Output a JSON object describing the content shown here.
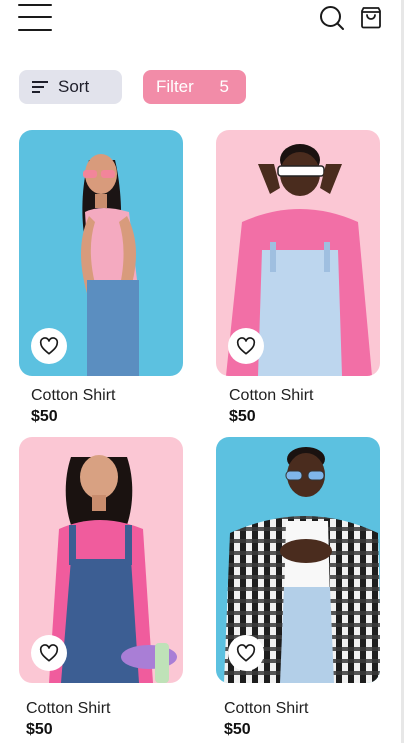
{
  "header": {
    "menu_icon": "hamburger-menu-icon",
    "search_icon": "search-icon",
    "bag_icon": "shopping-bag-icon"
  },
  "toolbar": {
    "sort_label": "Sort",
    "sort_icon": "sort-lines-icon",
    "filter_label": "Filter",
    "filter_count": "5"
  },
  "colors": {
    "accent_pink": "#f28ca8",
    "sort_bg": "#e2e3ec",
    "photo_blue": "#5cc1e0",
    "photo_pink": "#fbc7d4"
  },
  "products": [
    {
      "title": "Cotton Shirt",
      "price": "$50",
      "photo_bg": "#5cc1e0",
      "favorite_icon": "heart-outline-icon"
    },
    {
      "title": "Cotton Shirt",
      "price": "$50",
      "photo_bg": "#fbc7d4",
      "favorite_icon": "heart-outline-icon"
    },
    {
      "title": "Cotton Shirt",
      "price": "$50",
      "photo_bg": "#fbc7d4",
      "favorite_icon": "heart-outline-icon"
    },
    {
      "title": "Cotton Shirt",
      "price": "$50",
      "photo_bg": "#5cc1e0",
      "favorite_icon": "heart-outline-icon"
    }
  ]
}
